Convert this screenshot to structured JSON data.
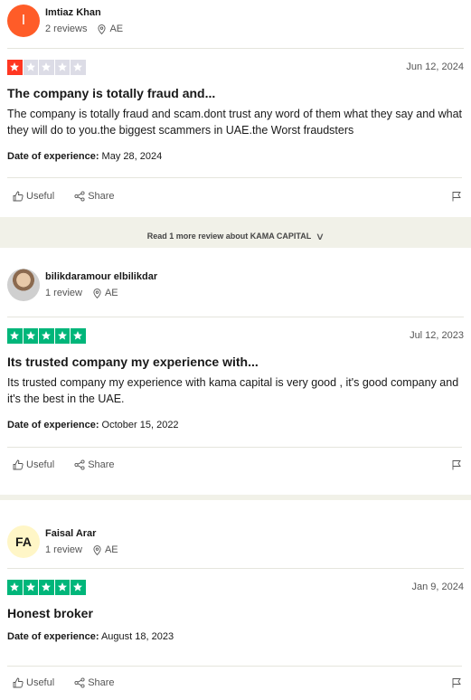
{
  "colors": {
    "star_red": "#ff3722",
    "star_green": "#00b67a",
    "star_empty": "#dcdce6",
    "avatar_orange": "#ff5c28",
    "avatar_yellow": "#fff6c7"
  },
  "reviews": [
    {
      "name": "Imtiaz Khan",
      "initials": "I",
      "review_count": "2 reviews",
      "country": "AE",
      "rating": 1,
      "date": "Jun 12, 2024",
      "title": "The company is totally fraud and...",
      "body": "The company is totally fraud and scam.dont trust any word of them what they say and what they will do to you.the biggest scammers in UAE.the Worst fraudsters",
      "experience_label": "Date of experience:",
      "experience_date": "May 28, 2024"
    },
    {
      "name": "bilikdaramour elbilikdar",
      "initials": "",
      "review_count": "1 review",
      "country": "AE",
      "rating": 5,
      "date": "Jul 12, 2023",
      "title": "Its trusted company my experience with...",
      "body": "Its trusted company my experience with kama capital is very good , it's good company and it's the best in the UAE.",
      "experience_label": "Date of experience:",
      "experience_date": "October 15, 2022"
    },
    {
      "name": "Faisal Arar",
      "initials": "FA",
      "review_count": "1 review",
      "country": "AE",
      "rating": 5,
      "date": "Jan 9, 2024",
      "title": "Honest broker",
      "body": "",
      "experience_label": "Date of experience:",
      "experience_date": "August 18, 2023"
    }
  ],
  "actions": {
    "useful": "Useful",
    "share": "Share"
  },
  "read_more": "Read 1 more review about KAMA CAPITAL"
}
